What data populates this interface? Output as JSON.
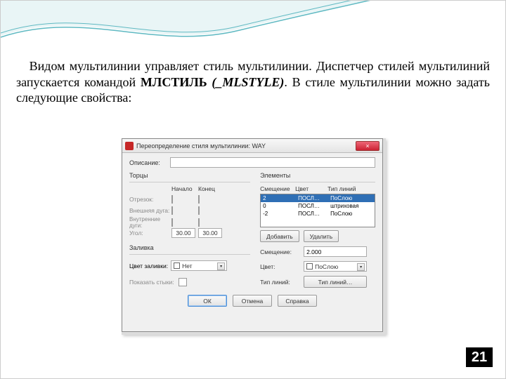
{
  "paragraph": {
    "t1": "Видом мультилинии управляет стиль мультилинии. Диспетчер стилей мультилиний запускается командой ",
    "cmd_ru": "МЛСТИЛЬ",
    "cmd_en": "(_MLSTYLE)",
    "t2": ". В стиле мультилинии можно задать следующие свойства:"
  },
  "dialog": {
    "title": "Переопределение стиля мультилинии: WAY",
    "close": "×",
    "desc_label": "Описание:",
    "caps": {
      "title": "Торцы",
      "head_start": "Начало",
      "head_end": "Конец",
      "row_line": "Отрезок:",
      "row_outer": "Внешняя дуга:",
      "row_inner": "Внутренние дуги:",
      "row_angle": "Угол:",
      "angle_start": "30.00",
      "angle_end": "30.00"
    },
    "fill": {
      "title": "Заливка",
      "label": "Цвет заливки:",
      "value": "Нет"
    },
    "joints": {
      "label": "Показать стыки:"
    },
    "elements": {
      "title": "Элементы",
      "h_offset": "Смещение",
      "h_color": "Цвет",
      "h_ltype": "Тип линий",
      "rows": [
        {
          "offset": "2",
          "color": "ПОСЛ…",
          "ltype": "ПоСлою"
        },
        {
          "offset": "0",
          "color": "ПОСЛ…",
          "ltype": "штриховая"
        },
        {
          "offset": "-2",
          "color": "ПОСЛ…",
          "ltype": "ПоСлою"
        }
      ],
      "btn_add": "Добавить",
      "btn_del": "Удалить",
      "offset_label": "Смещение:",
      "offset_value": "2.000",
      "color_label": "Цвет:",
      "color_value": "ПоСлою",
      "ltype_label": "Тип линий:",
      "ltype_btn": "Тип линий…"
    },
    "footer": {
      "ok": "ОК",
      "cancel": "Отмена",
      "help": "Справка"
    }
  },
  "page_number": "21"
}
